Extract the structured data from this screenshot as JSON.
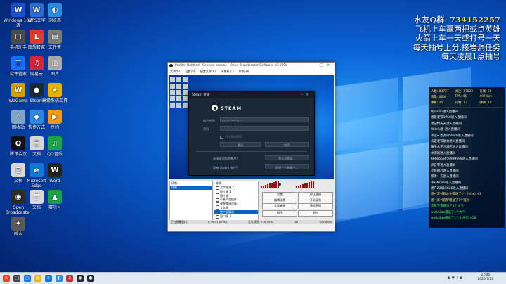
{
  "desktop_icons": [
    {
      "label": "Windows 10激活",
      "glyph": "W",
      "color": "#1c4fcf"
    },
    {
      "label": "WPS文字",
      "glyph": "W",
      "color": "#2a6fd6"
    },
    {
      "label": "浏览器",
      "glyph": "◐",
      "color": "#2b8de2"
    },
    {
      "label": "手机助手",
      "glyph": "▢",
      "color": "#4b4b4b"
    },
    {
      "label": "联想管家",
      "glyph": "L",
      "color": "#e23b2e"
    },
    {
      "label": "文件夹",
      "glyph": "▤",
      "color": "#7b7b7b"
    },
    {
      "label": "软件管家",
      "glyph": "☰",
      "color": "#1b6cff"
    },
    {
      "label": "网易云",
      "glyph": "♫",
      "color": "#d6243a"
    },
    {
      "label": "图片",
      "glyph": "▥",
      "color": "#a9a9a9"
    },
    {
      "label": "WeGame",
      "glyph": "W",
      "color": "#d3a100"
    },
    {
      "label": "Steam",
      "glyph": "●",
      "color": "#1b2838"
    },
    {
      "label": "高级系统工具",
      "glyph": "★",
      "color": "#e3b400"
    },
    {
      "label": "回收站",
      "glyph": "♲",
      "color": "#7fa6c9"
    },
    {
      "label": "快捷方式",
      "glyph": "◆",
      "color": "#2d87e5"
    },
    {
      "label": "豆约",
      "glyph": "▶",
      "color": "#f19a1a"
    },
    {
      "label": "腾讯会议",
      "glyph": "Q",
      "color": "#111111"
    },
    {
      "label": "文档",
      "glyph": "≣",
      "color": "#d9d9d9"
    },
    {
      "label": "QQ音乐",
      "glyph": "♫",
      "color": "#19a64b"
    },
    {
      "label": "文档",
      "glyph": "≣",
      "color": "#d9d9d9"
    },
    {
      "label": "Microsoft Edge",
      "glyph": "e",
      "color": "#0a7ad4"
    },
    {
      "label": "Word",
      "glyph": "W",
      "color": "#222222"
    },
    {
      "label": "Open Broadcaster",
      "glyph": "◉",
      "color": "#2b2b2b"
    },
    {
      "label": "文档",
      "glyph": "≣",
      "color": "#d9d9d9"
    },
    {
      "label": "赛尔号",
      "glyph": "▲",
      "color": "#1aa34a"
    },
    {
      "label": "脚本",
      "glyph": "✦",
      "color": "#5a5a5a"
    }
  ],
  "stream_overlay": {
    "qq_prefix": "水友Q群:",
    "qq_number": "734152257",
    "line1": "飞机上车赢两把或点英雄",
    "line2": "火箭上车一天或打号一天",
    "line3": "每天抽号上分,接岩洞任务",
    "line4": "每天凌晨1点抽号"
  },
  "live_panel": {
    "stats": [
      "人数: 83727",
      "关注: 17822",
      "在线: 28",
      "容量: 00%",
      "FPS: 45",
      "497kb/s",
      "弹幕: 25",
      "礼物: 13",
      "弹幕: 10"
    ],
    "chat": [
      {
        "text": "Uparxlu进入直播间",
        "style": ""
      },
      {
        "text": "感恩老铁1950进入直播间",
        "style": ""
      },
      {
        "text": "我记约天天进入直播间",
        "style": ""
      },
      {
        "text": "Wiltrix者 进入直播间",
        "style": ""
      },
      {
        "text": "幸运• 漂流间Shark进入直播间",
        "style": ""
      },
      {
        "text": "肯定老铁助力进入直播间",
        "style": ""
      },
      {
        "text": "昧子木学习酒店进入直播间",
        "style": ""
      },
      {
        "text": "水清的进入直播间",
        "style": ""
      },
      {
        "text": "6666666659999999进入直播间",
        "style": ""
      },
      {
        "text": "声音零进入直播间",
        "style": ""
      },
      {
        "text": "老铁微若进入直播间",
        "style": ""
      },
      {
        "text": "排清一天进入直播间",
        "style": ""
      },
      {
        "text": "幸• Mr9m进入直播间",
        "style": ""
      },
      {
        "text": "用户Z3615626进入直播间",
        "style": ""
      },
      {
        "text": "感• 流书数公主赠送了1个小心心 +1",
        "style": "hl"
      },
      {
        "text": "感• 流书云梦赠送了7个强列",
        "style": "hl"
      },
      {
        "text": "流星字等赠送了1个大气",
        "style": "green"
      },
      {
        "text": "wolta3aa赠送了1个大气",
        "style": "green"
      },
      {
        "text": "wolta3aa赠送了1个小木剑 +16",
        "style": "green"
      }
    ]
  },
  "obs": {
    "title": "Profile: Untitled - Scenes: scenes - Open Broadcaster Software v0.659b",
    "menu": [
      "文件(F)",
      "设置(S)",
      "配置文件(P)",
      "场景集(C)",
      "帮助(H)"
    ],
    "scenes_header": "场景:",
    "scene_selected": "场景",
    "sources_header": "来源:",
    "sources": [
      "文字源源 2",
      "图片源 2",
      "图片源",
      "小麦声音插件",
      "视频捕获设备",
      "文字源",
      "整个屏幕源",
      "窗口源 2"
    ],
    "source_selected_index": 6,
    "buttons": {
      "settings": "设置",
      "stop_stream": "停止直播",
      "edit_scene": "编辑场景",
      "start_record": "开始录制",
      "global_sources": "全局来源",
      "preview_only": "预览直播",
      "plugins": "插件",
      "exit": "退出"
    },
    "status": [
      "正在直播窗口",
      "0:39:41 (LIVE)",
      "丢失帧数: 0 (0.00%)",
      "60",
      "5243kb/s"
    ]
  },
  "steam": {
    "title": "Steam 登录",
    "brand": "STEAM",
    "account_label": "帐户名称",
    "account_value": "••••••••••••",
    "password_label": "密码",
    "password_value": "••••••••••",
    "remember_label": "记住我的密码",
    "login_button": "登录",
    "cancel_button": "取消",
    "forgot_question": "无法访问您的帐户?",
    "forgot_button": "我无法登录...",
    "create_question": "没有 Steam 帐户?",
    "create_button": "创建一个新帐户..."
  },
  "taskbar": {
    "items": [
      {
        "glyph": "S",
        "color": "#e8411f"
      },
      {
        "glyph": "◯",
        "color": "#444444"
      },
      {
        "glyph": "▢",
        "color": "#1a73e8"
      },
      {
        "glyph": "▤",
        "color": "#f0b400"
      },
      {
        "glyph": "e",
        "color": "#0a7ad4"
      },
      {
        "glyph": "◐",
        "color": "#2b8de2"
      },
      {
        "glyph": "♫",
        "color": "#d6243a"
      },
      {
        "glyph": "◉",
        "color": "#2b2b2b"
      },
      {
        "glyph": "●",
        "color": "#1b2838"
      }
    ],
    "time": "22:06",
    "date": "2020/7/27"
  }
}
